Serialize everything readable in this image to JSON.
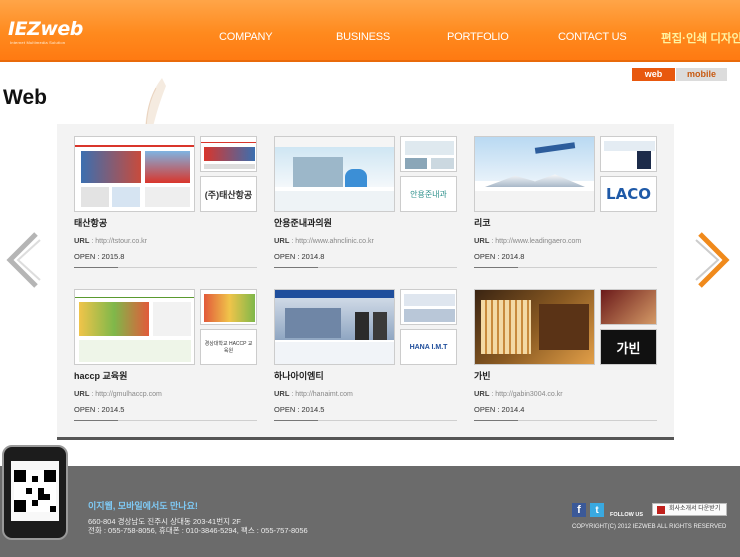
{
  "header": {
    "logo_main": "IEZweb",
    "logo_sub": "Internet Multimedia Solution",
    "nav": [
      "COMPANY",
      "BUSINESS",
      "PORTFOLIO",
      "CONTACT US"
    ],
    "design_link": "편집·인쇄 디자인"
  },
  "toggle": {
    "web": "web",
    "mobile": "mobile"
  },
  "page_title": "Web",
  "portfolio": [
    {
      "name": "태산항공",
      "url_label": "URL",
      "url": "http://tstour.co.kr",
      "open": "OPEN : 2015.8",
      "logo_text": "(주)태산항공",
      "theme": "#d9352b"
    },
    {
      "name": "안용준내과의원",
      "url_label": "URL",
      "url": "http://www.ahnclinic.co.kr",
      "open": "OPEN : 2014.8",
      "logo_text": "안용준내과",
      "theme": "#2a8f8a"
    },
    {
      "name": "리코",
      "url_label": "URL",
      "url": "http://www.leadingaero.com",
      "open": "OPEN : 2014.8",
      "logo_text": "LACO",
      "theme": "#1f5aa8"
    },
    {
      "name": "haccp 교육원",
      "url_label": "URL",
      "url": "http://gmulhaccp.com",
      "open": "OPEN : 2014.5",
      "logo_text": "경상대학교 HACCP 교육원",
      "theme": "#5a9a2e"
    },
    {
      "name": "하나아이엠티",
      "url_label": "URL",
      "url": "http://hanaimt.com",
      "open": "OPEN : 2014.5",
      "logo_text": "HANA I.M.T",
      "theme": "#1f4e9c"
    },
    {
      "name": "가빈",
      "url_label": "URL",
      "url": "http://gabin3004.co.kr",
      "open": "OPEN : 2014.4",
      "logo_text": "가빈",
      "theme": "#8a5a22"
    }
  ],
  "footer": {
    "slogan": "이지웹, 모바일에서도 만나요!",
    "address": "660-804 경상남도 진주시 상대동 203-41번지 2F",
    "tel": "전화 : 055-758-8056, 휴대폰 : 010-3846-5294, 팩스 : 055-757-8056",
    "follow": "FOLLOW US",
    "download": "회사소개서 다운받기",
    "copyright": "COPYRIGHT(C) 2012 IEZWEB ALL RIGHTS RESERVED"
  },
  "colors": {
    "accent": "#ff7a12",
    "accent_dark": "#e8580e",
    "footer": "#6b6b6b",
    "slogan": "#7fcaf5"
  },
  "icons": [
    "logo",
    "feather-deco",
    "chevron-left-icon",
    "chevron-right-icon",
    "qr-code-icon",
    "facebook-icon",
    "twitter-icon",
    "pdf-icon"
  ]
}
